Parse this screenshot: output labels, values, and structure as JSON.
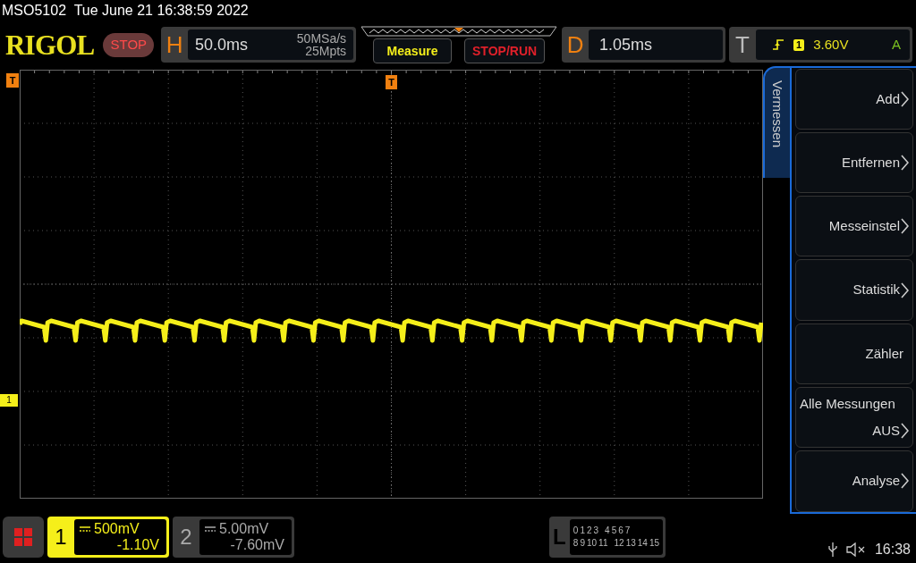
{
  "title": "MSO5102  Tue June 21 16:38:59 2022",
  "header": {
    "logo": "RIGOL",
    "run_state": "STOP",
    "horizontal": {
      "label": "H",
      "timebase": "50.0ms",
      "sample_rate": "50MSa/s",
      "memory_depth": "25Mpts"
    },
    "buttons": [
      {
        "label": "Measure",
        "kind": "measure"
      },
      {
        "label": "STOP/RUN",
        "kind": "stoprun"
      }
    ],
    "delay": {
      "label": "D",
      "value": "1.05ms"
    },
    "trigger": {
      "label": "T",
      "source": "1",
      "level": "3.60V",
      "mode": "A"
    }
  },
  "plot": {
    "trigger_position_marker": "T",
    "trigger_level_marker": "T",
    "channel_marker": "1"
  },
  "menu": {
    "tab": "Vermessen",
    "items": [
      {
        "label": "Add",
        "kind": "submenu"
      },
      {
        "label": "Entfernen",
        "kind": "submenu"
      },
      {
        "label": "Messeinstel",
        "kind": "submenu"
      },
      {
        "label": "Statistik",
        "kind": "submenu"
      },
      {
        "label": "Zähler",
        "kind": "plain"
      },
      {
        "label": "Alle Messungen",
        "kind": "setting",
        "value": "AUS"
      },
      {
        "label": "Analyse",
        "kind": "submenu"
      }
    ]
  },
  "channels": [
    {
      "number": "1",
      "scale": "500mV",
      "offset": "-1.10V",
      "selected": true
    },
    {
      "number": "2",
      "scale": "5.00mV",
      "offset": "-7.60mV",
      "selected": false
    }
  ],
  "logic": {
    "label": "L",
    "row_1": [
      "0",
      "1",
      "2",
      "3",
      "4",
      "5",
      "6",
      "7"
    ],
    "row_2": [
      "8",
      "9",
      "10",
      "11",
      "12",
      "13",
      "14",
      "15"
    ]
  },
  "status_bar": {
    "time": "16:38"
  }
}
